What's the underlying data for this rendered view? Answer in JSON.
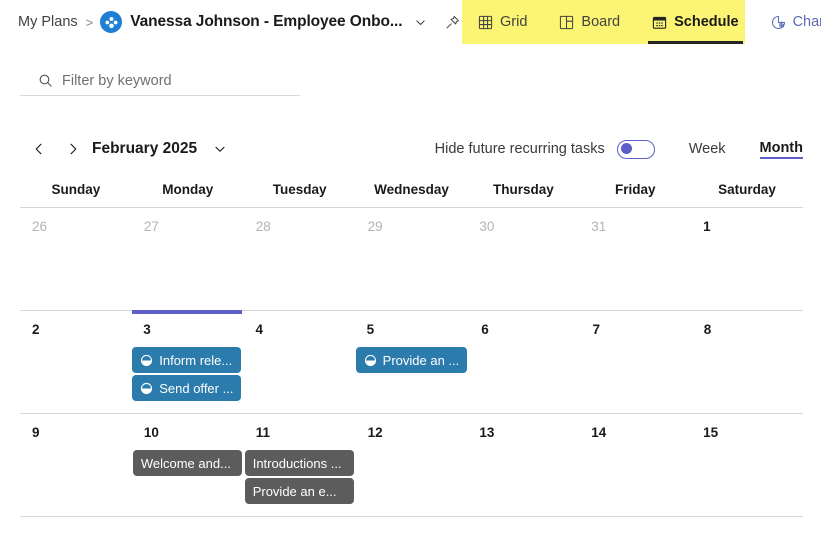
{
  "header": {
    "breadcrumb_root": "My Plans",
    "breadcrumb_separator": ">",
    "plan_title": "Vanessa Johnson - Employee Onbo...",
    "plan_icon": "planner-app-icon",
    "chevron_icon": "chevron-down-icon",
    "pin_icon": "pin-icon",
    "highlight_color": "#fcf573"
  },
  "tabs": [
    {
      "label": "Grid",
      "icon": "grid-icon",
      "selected": false
    },
    {
      "label": "Board",
      "icon": "board-icon",
      "selected": false
    },
    {
      "label": "Schedule",
      "icon": "calendar-icon",
      "selected": true
    },
    {
      "label": "Charts",
      "icon": "chart-icon",
      "selected": false
    }
  ],
  "filter": {
    "placeholder": "Filter by keyword",
    "value": "",
    "icon": "search-icon"
  },
  "calendar_toolbar": {
    "prev_icon": "chevron-left-icon",
    "next_icon": "chevron-right-icon",
    "month_label": "February 2025",
    "month_chevron_icon": "chevron-down-icon",
    "recurring_label": "Hide future recurring tasks",
    "recurring_enabled": false,
    "view_week": "Week",
    "view_month": "Month",
    "active_view": "Month",
    "accent_color": "#5b5fc7"
  },
  "calendar": {
    "day_headers": [
      "Sunday",
      "Monday",
      "Tuesday",
      "Wednesday",
      "Thursday",
      "Friday",
      "Saturday"
    ],
    "weeks": [
      {
        "days": [
          {
            "num": "26",
            "out_of_month": true,
            "today": false,
            "tasks": []
          },
          {
            "num": "27",
            "out_of_month": true,
            "today": false,
            "tasks": []
          },
          {
            "num": "28",
            "out_of_month": true,
            "today": false,
            "tasks": []
          },
          {
            "num": "29",
            "out_of_month": true,
            "today": false,
            "tasks": []
          },
          {
            "num": "30",
            "out_of_month": true,
            "today": false,
            "tasks": []
          },
          {
            "num": "31",
            "out_of_month": true,
            "today": false,
            "tasks": []
          },
          {
            "num": "1",
            "out_of_month": false,
            "today": false,
            "tasks": []
          }
        ]
      },
      {
        "days": [
          {
            "num": "2",
            "out_of_month": false,
            "today": false,
            "tasks": []
          },
          {
            "num": "3",
            "out_of_month": false,
            "today": true,
            "tasks": [
              {
                "label": "Inform rele...",
                "color": "blue",
                "icon": "half-progress-icon"
              },
              {
                "label": "Send offer ...",
                "color": "blue",
                "icon": "half-progress-icon"
              }
            ]
          },
          {
            "num": "4",
            "out_of_month": false,
            "today": false,
            "tasks": []
          },
          {
            "num": "5",
            "out_of_month": false,
            "today": false,
            "tasks": [
              {
                "label": "Provide an ...",
                "color": "blue",
                "icon": "half-progress-icon"
              }
            ]
          },
          {
            "num": "6",
            "out_of_month": false,
            "today": false,
            "tasks": []
          },
          {
            "num": "7",
            "out_of_month": false,
            "today": false,
            "tasks": []
          },
          {
            "num": "8",
            "out_of_month": false,
            "today": false,
            "tasks": []
          }
        ]
      },
      {
        "days": [
          {
            "num": "9",
            "out_of_month": false,
            "today": false,
            "tasks": []
          },
          {
            "num": "10",
            "out_of_month": false,
            "today": false,
            "tasks": [
              {
                "label": "Welcome and...",
                "color": "gray",
                "icon": ""
              }
            ]
          },
          {
            "num": "11",
            "out_of_month": false,
            "today": false,
            "tasks": [
              {
                "label": "Introductions ...",
                "color": "gray",
                "icon": ""
              },
              {
                "label": "Provide an e...",
                "color": "gray",
                "icon": ""
              }
            ]
          },
          {
            "num": "12",
            "out_of_month": false,
            "today": false,
            "tasks": []
          },
          {
            "num": "13",
            "out_of_month": false,
            "today": false,
            "tasks": []
          },
          {
            "num": "14",
            "out_of_month": false,
            "today": false,
            "tasks": []
          },
          {
            "num": "15",
            "out_of_month": false,
            "today": false,
            "tasks": []
          }
        ]
      }
    ]
  }
}
